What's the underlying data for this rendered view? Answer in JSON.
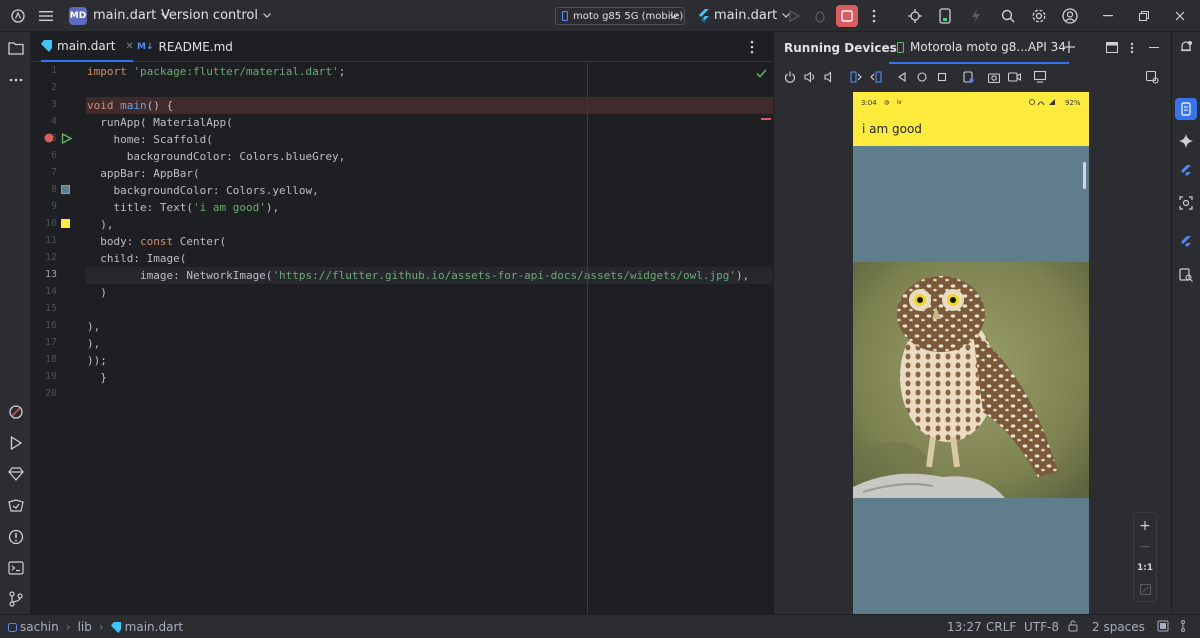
{
  "titlebar": {
    "project_badge": "MD",
    "project_name": "main.dart",
    "vcs": "Version control",
    "device": "moto g85 5G (mobile)",
    "run_config": "main.dart"
  },
  "editor": {
    "tabs": [
      {
        "label": "main.dart",
        "active": true
      },
      {
        "label": "README.md",
        "active": false
      }
    ],
    "line_numbers": [
      "1",
      "2",
      "3",
      "4",
      "5",
      "6",
      "7",
      "8",
      "9",
      "10",
      "11",
      "12",
      "13",
      "14",
      "15",
      "16",
      "17",
      "18",
      "19",
      "20"
    ],
    "current_line": "13"
  },
  "running_devices": {
    "title": "Running Devices",
    "device_tab": "Motorola moto g8...API 34",
    "phone": {
      "time": "3:04",
      "battery": "92%",
      "app_title": "i am good",
      "colors": {
        "appbar": "#ffeb3b",
        "background": "#607d8b"
      }
    },
    "zoom": {
      "fit": "1:1"
    }
  },
  "statusbar": {
    "breadcrumb": [
      "sachin",
      "lib",
      "main.dart"
    ],
    "position": "13:27",
    "line_sep": "CRLF",
    "encoding": "UTF-8",
    "indent": "2 spaces"
  }
}
